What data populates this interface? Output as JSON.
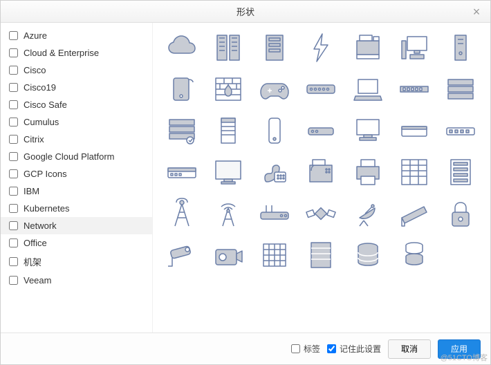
{
  "dialog": {
    "title": "形状",
    "close_label": "×"
  },
  "sidebar": {
    "categories": [
      {
        "label": "Azure",
        "checked": false,
        "selected": false
      },
      {
        "label": "Cloud & Enterprise",
        "checked": false,
        "selected": false
      },
      {
        "label": "Cisco",
        "checked": false,
        "selected": false
      },
      {
        "label": "Cisco19",
        "checked": false,
        "selected": false
      },
      {
        "label": "Cisco Safe",
        "checked": false,
        "selected": false
      },
      {
        "label": "Cumulus",
        "checked": false,
        "selected": false
      },
      {
        "label": "Citrix",
        "checked": false,
        "selected": false
      },
      {
        "label": "Google Cloud Platform",
        "checked": false,
        "selected": false
      },
      {
        "label": "GCP Icons",
        "checked": false,
        "selected": false
      },
      {
        "label": "IBM",
        "checked": false,
        "selected": false
      },
      {
        "label": "Kubernetes",
        "checked": false,
        "selected": false
      },
      {
        "label": "Network",
        "checked": false,
        "selected": true
      },
      {
        "label": "Office",
        "checked": false,
        "selected": false
      },
      {
        "label": "机架",
        "checked": false,
        "selected": false
      },
      {
        "label": "Veeam",
        "checked": false,
        "selected": false
      }
    ]
  },
  "shapes": {
    "items": [
      {
        "name": "cloud-icon"
      },
      {
        "name": "building-icon"
      },
      {
        "name": "server-unit-icon"
      },
      {
        "name": "signal-bolt-icon"
      },
      {
        "name": "copier-icon"
      },
      {
        "name": "pc-monitor-icon"
      },
      {
        "name": "tower-pc-icon"
      },
      {
        "name": "external-drive-icon"
      },
      {
        "name": "firewall-icon"
      },
      {
        "name": "gamepad-icon"
      },
      {
        "name": "switch-bar-icon"
      },
      {
        "name": "laptop-icon"
      },
      {
        "name": "patch-panel-icon"
      },
      {
        "name": "rack-server-icon"
      },
      {
        "name": "server-stack-icon"
      },
      {
        "name": "rack-cabinet-icon"
      },
      {
        "name": "phone-device-icon"
      },
      {
        "name": "modem-icon"
      },
      {
        "name": "desktop-icon"
      },
      {
        "name": "appliance-icon"
      },
      {
        "name": "switch-long-icon"
      },
      {
        "name": "switch-device-icon"
      },
      {
        "name": "monitor-icon"
      },
      {
        "name": "telephone-icon"
      },
      {
        "name": "fax-icon"
      },
      {
        "name": "printer-icon"
      },
      {
        "name": "rack-array-icon"
      },
      {
        "name": "server-tall-icon"
      },
      {
        "name": "radio-tower-icon"
      },
      {
        "name": "wifi-tower-icon"
      },
      {
        "name": "router-icon"
      },
      {
        "name": "satellite-icon"
      },
      {
        "name": "satellite-dish-icon"
      },
      {
        "name": "scanner-icon"
      },
      {
        "name": "padlock-icon"
      },
      {
        "name": "security-camera-icon"
      },
      {
        "name": "camera-icon"
      },
      {
        "name": "disk-array-icon"
      },
      {
        "name": "storage-rack-icon"
      },
      {
        "name": "database-icon"
      },
      {
        "name": "cylinder-stack-icon"
      },
      {
        "name": "blank-icon"
      }
    ]
  },
  "footer": {
    "labels_checkbox": {
      "label": "标签",
      "checked": false
    },
    "remember_checkbox": {
      "label": "记住此设置",
      "checked": true
    },
    "cancel": "取消",
    "apply": "应用"
  },
  "watermark": "@51CTO博客",
  "palette": {
    "icon_stroke": "#6b7fa8",
    "icon_fill": "#c8ccd4",
    "accent": "#1e88e5"
  }
}
